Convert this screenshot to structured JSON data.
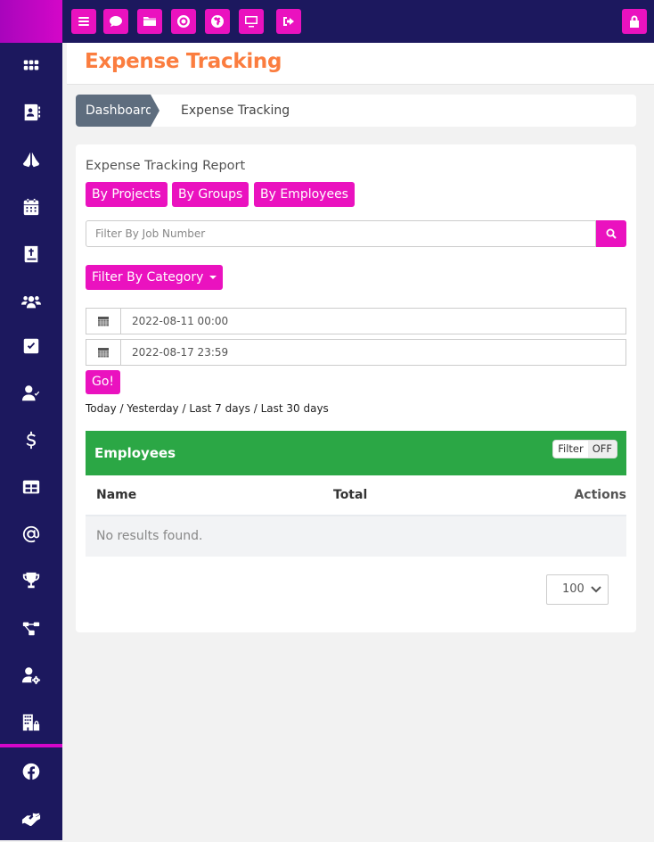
{
  "sidebar": {
    "items": [
      {
        "icon": "grid-icon",
        "label": "Apps"
      },
      {
        "icon": "address-book-icon",
        "label": "Contacts"
      },
      {
        "icon": "praying-hands-icon",
        "label": "Prayer"
      },
      {
        "icon": "calendar-icon",
        "label": "Calendar"
      },
      {
        "icon": "bible-icon",
        "label": "Bible"
      },
      {
        "icon": "users-icon",
        "label": "Groups"
      },
      {
        "icon": "check-square-icon",
        "label": "Tasks"
      },
      {
        "icon": "user-check-icon",
        "label": "Attendance"
      },
      {
        "icon": "dollar-icon",
        "label": "Finance"
      },
      {
        "icon": "table-icon",
        "label": "Tables"
      },
      {
        "icon": "at-icon",
        "label": "Email"
      },
      {
        "icon": "trophy-icon",
        "label": "Achievements"
      },
      {
        "icon": "sitemap-icon",
        "label": "Structure"
      },
      {
        "icon": "user-cog-icon",
        "label": "User Settings"
      },
      {
        "icon": "building-lock-icon",
        "label": "Organization"
      }
    ],
    "bottom_items": [
      {
        "icon": "facebook-icon",
        "label": "Facebook"
      },
      {
        "icon": "handshake-icon",
        "label": "Partners"
      }
    ]
  },
  "topbar": {
    "buttons": [
      {
        "icon": "menu-icon"
      },
      {
        "icon": "chat-icon"
      },
      {
        "icon": "folder-icon"
      },
      {
        "icon": "lifebuoy-icon"
      },
      {
        "icon": "globe-icon"
      },
      {
        "icon": "desktop-icon"
      },
      {
        "icon": "sign-out-icon"
      }
    ],
    "right_button": {
      "icon": "lock-icon"
    }
  },
  "header": {
    "title": "Expense Tracking"
  },
  "breadcrumb": {
    "root": "Dashboard",
    "current": "Expense Tracking"
  },
  "report": {
    "title": "Expense Tracking Report",
    "group_buttons": [
      "By Projects",
      "By Groups",
      "By Employees"
    ],
    "job_filter": {
      "placeholder": "Filter By Job Number",
      "value": ""
    },
    "category_button": "Filter By Category",
    "date_from": "2022-08-11 00:00",
    "date_to": "2022-08-17 23:59",
    "go_button": "Go!",
    "quick_ranges": [
      "Today",
      "Yesterday",
      "Last 7 days",
      "Last 30 days"
    ],
    "range_separator": " / "
  },
  "employees": {
    "title": "Employees",
    "filter_toggle": {
      "label": "Filter",
      "state": "OFF"
    },
    "columns": [
      "Name",
      "Total",
      "Actions"
    ],
    "rows": [],
    "empty_text": "No results found.",
    "page_size": "100"
  },
  "colors": {
    "accent": "#ea12bf",
    "sidebar": "#1c185e",
    "title": "#fb7d3f",
    "panel_header": "#2ba745",
    "breadcrumb": "#5e6d7e"
  }
}
